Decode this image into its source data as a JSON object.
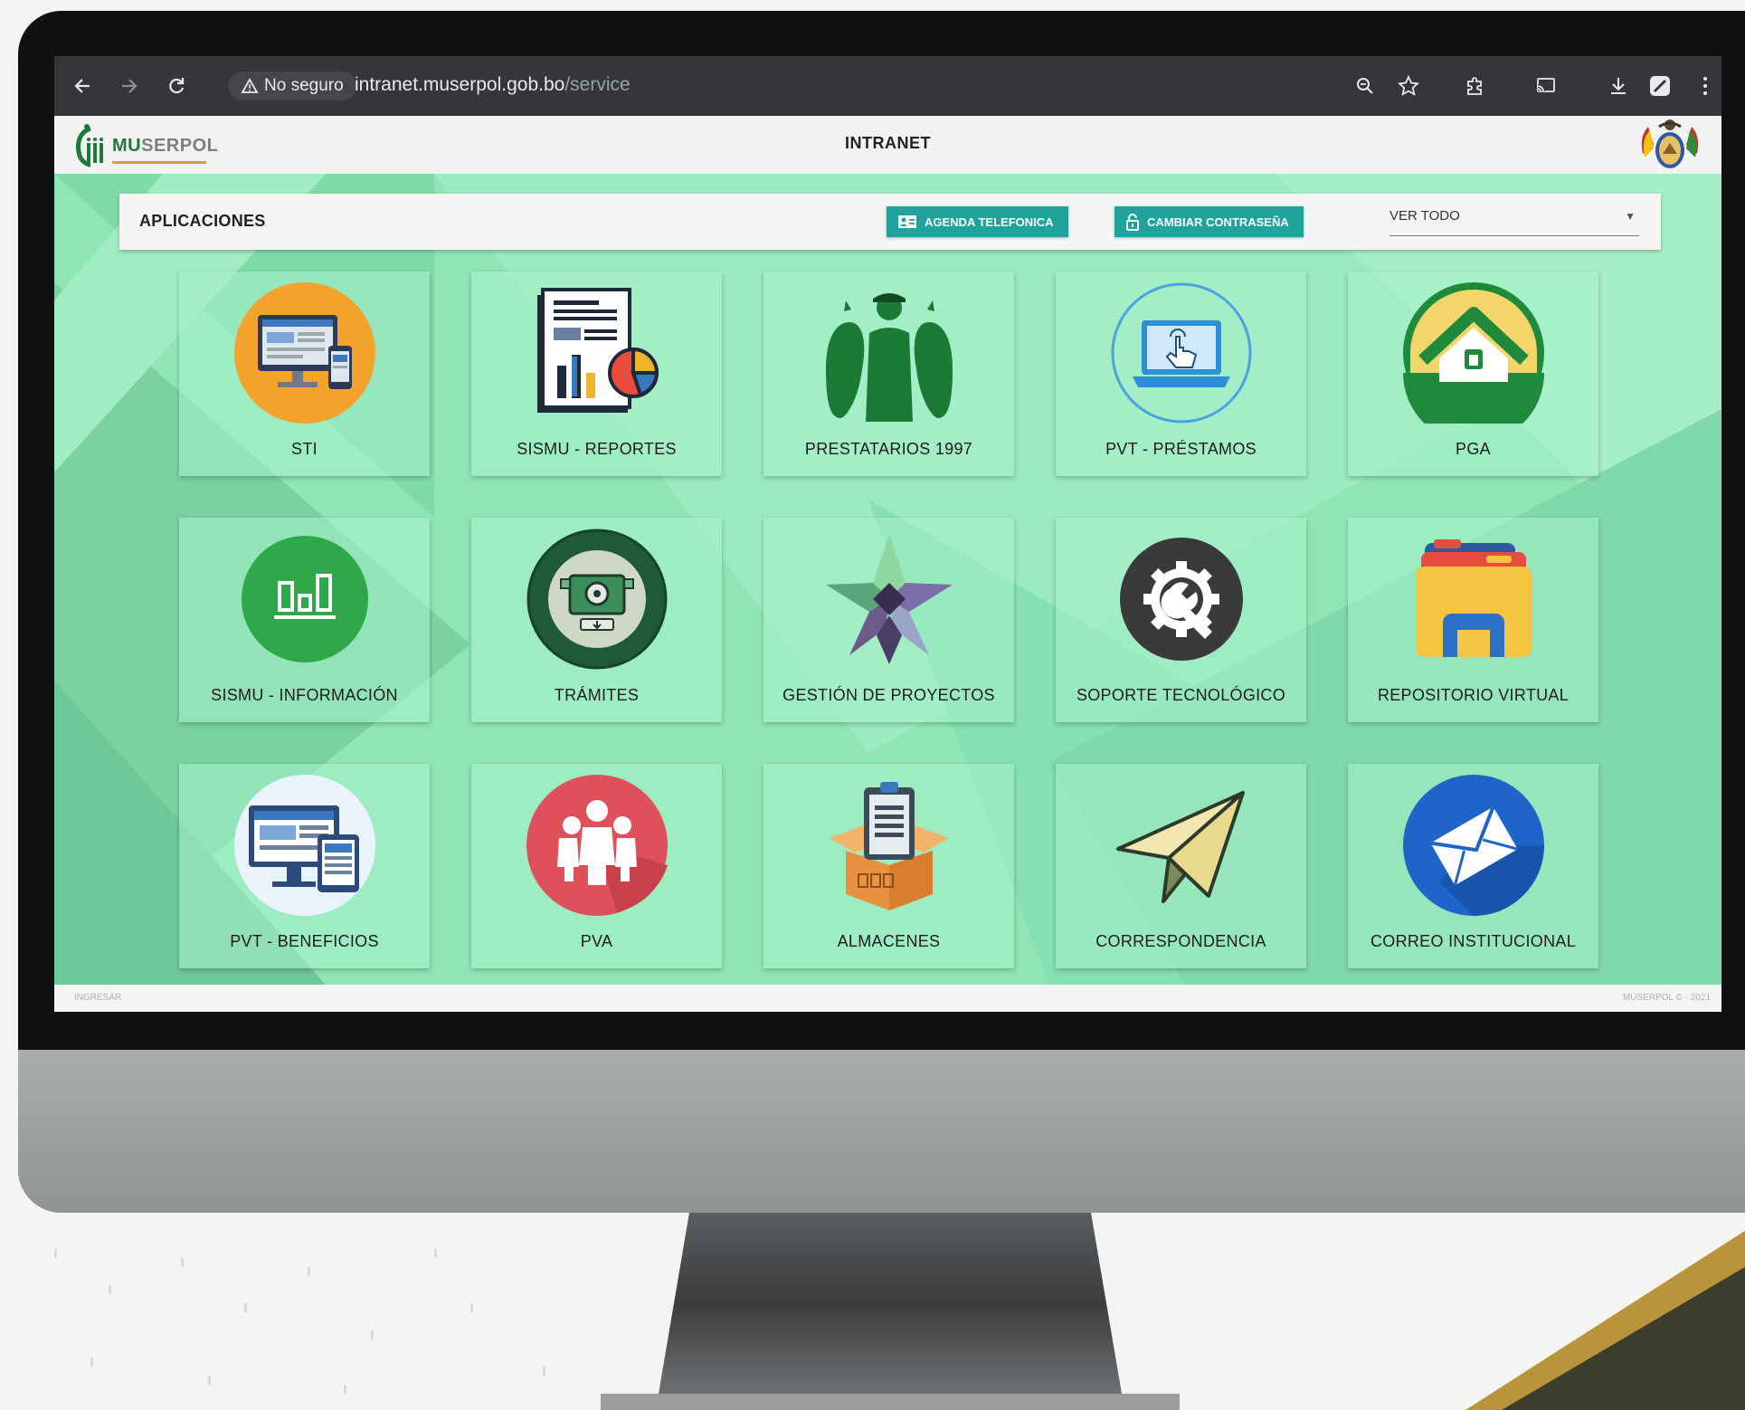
{
  "browser": {
    "security_label": "No seguro",
    "url_host": "intranet.muserpol.gob.bo",
    "url_path": "/service"
  },
  "header": {
    "logo_text_prefix": "MU",
    "logo_text_suffix": "SERPOL",
    "title": "INTRANET"
  },
  "toolbar": {
    "title": "APLICACIONES",
    "agenda_label": "AGENDA TELEFONICA",
    "password_label": "CAMBIAR CONTRASEÑA",
    "filter_value": "VER TODO"
  },
  "apps": [
    {
      "label": "STI",
      "icon": "sti-icon"
    },
    {
      "label": "SISMU - REPORTES",
      "icon": "reports-icon"
    },
    {
      "label": "PRESTATARIOS 1997",
      "icon": "borrowers-icon"
    },
    {
      "label": "PVT - PRÉSTAMOS",
      "icon": "laptop-touch-icon"
    },
    {
      "label": "PGA",
      "icon": "house-icon"
    },
    {
      "label": "SISMU - INFORMACIÓN",
      "icon": "bar-chart-icon"
    },
    {
      "label": "TRÁMITES",
      "icon": "procedures-seal-icon"
    },
    {
      "label": "GESTIÓN DE PROYECTOS",
      "icon": "project-star-icon"
    },
    {
      "label": "SOPORTE TECNOLÓGICO",
      "icon": "gear-wrench-icon"
    },
    {
      "label": "REPOSITORIO VIRTUAL",
      "icon": "folder-icon"
    },
    {
      "label": "PVT - BENEFICIOS",
      "icon": "devices-icon"
    },
    {
      "label": "PVA",
      "icon": "people-icon"
    },
    {
      "label": "ALMACENES",
      "icon": "warehouse-box-icon"
    },
    {
      "label": "CORRESPONDENCIA",
      "icon": "paper-plane-icon"
    },
    {
      "label": "CORREO INSTITUCIONAL",
      "icon": "envelope-icon"
    }
  ],
  "footer": {
    "left": "INGRESAR",
    "right": "MUSERPOL © - 2021"
  },
  "colors": {
    "content_bg": "#8fe6b4",
    "button": "#1fa39c",
    "browser_bar": "#35363a",
    "brand_green": "#1f7a3a"
  }
}
